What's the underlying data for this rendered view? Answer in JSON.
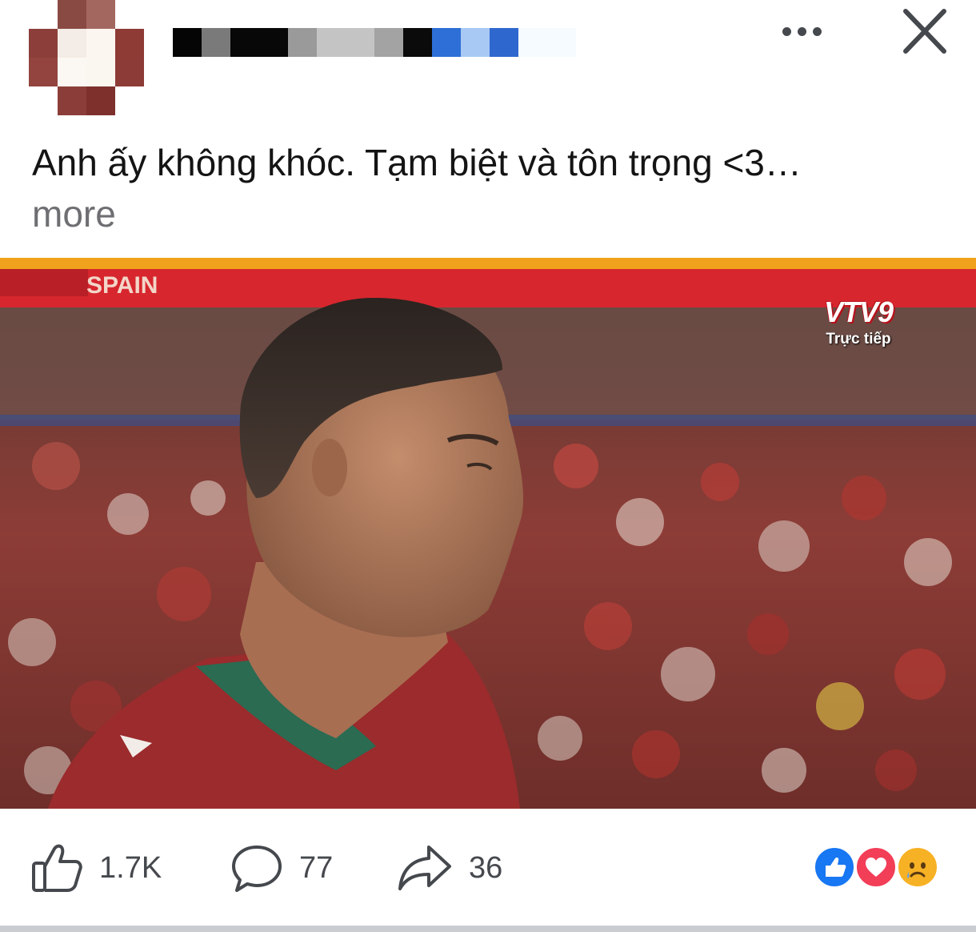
{
  "post": {
    "caption": "Anh ấy không khóc. Tạm biệt và tôn trọng <3…",
    "see_more": "more"
  },
  "photo": {
    "banner_text": "SPAIN",
    "broadcaster_logo": "VTV9",
    "broadcaster_status": "Trực tiếp"
  },
  "actions": {
    "like_count": "1.7K",
    "comment_count": "77",
    "share_count": "36"
  },
  "reactions": [
    "like-icon",
    "love-icon",
    "sad-icon"
  ],
  "colors": {
    "like_blue": "#1877f2",
    "love_red": "#f33e58",
    "sad_yellow": "#f7b125",
    "icon_gray": "#45484d"
  }
}
